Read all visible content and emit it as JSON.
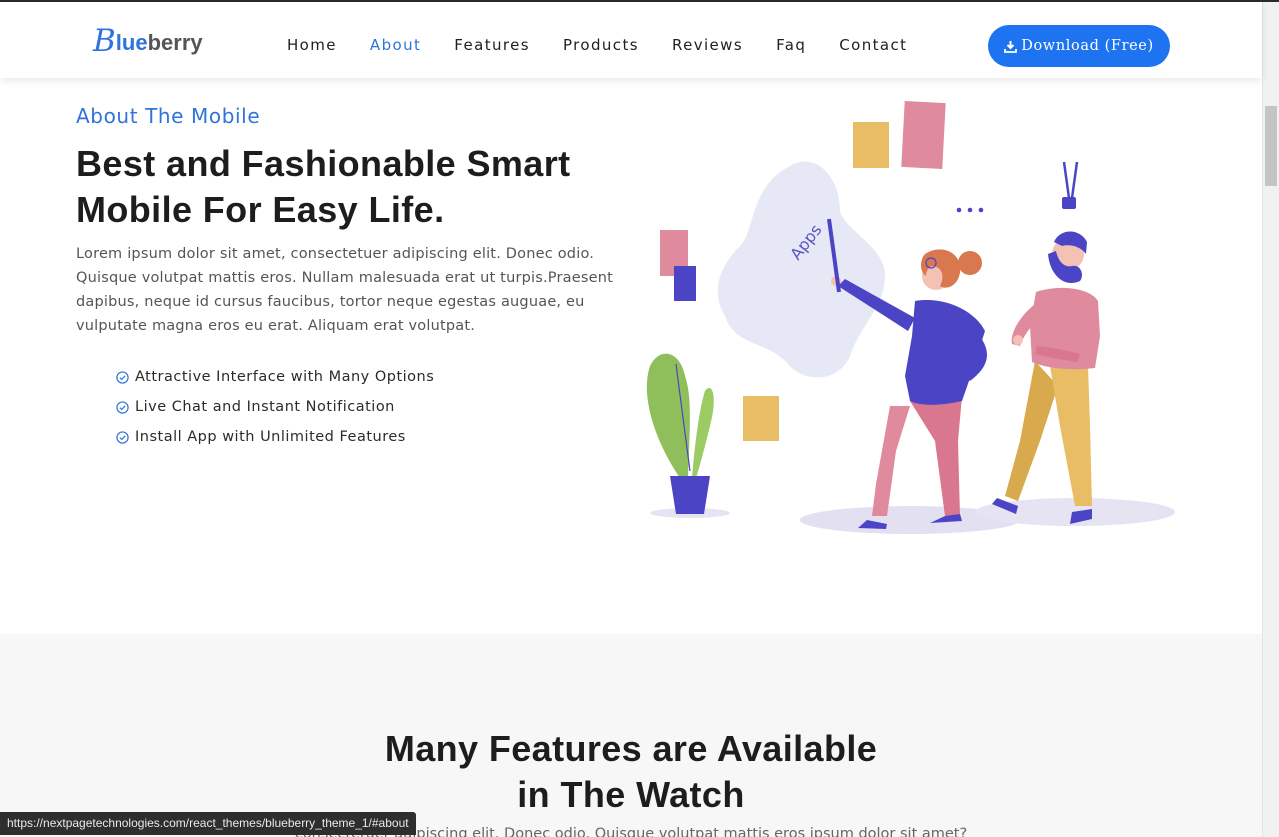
{
  "brand": {
    "letter": "B",
    "part_blue": "lue",
    "part_gray": "berry"
  },
  "nav": {
    "items": [
      {
        "label": "Home"
      },
      {
        "label": "About",
        "active": true
      },
      {
        "label": "Features"
      },
      {
        "label": "Products"
      },
      {
        "label": "Reviews"
      },
      {
        "label": "Faq"
      },
      {
        "label": "Contact"
      }
    ],
    "download_label": "Download (Free)"
  },
  "about": {
    "kicker": "About The Mobile",
    "title": "Best and Fashionable Smart Mobile For Easy Life.",
    "body": "Lorem ipsum dolor sit amet, consectetuer adipiscing elit. Donec odio. Quisque volutpat mattis eros. Nullam malesuada erat ut turpis.Praesent dapibus, neque id cursus faucibus, tortor neque egestas auguae, eu vulputate magna eros eu erat. Aliquam erat volutpat.",
    "features": [
      "Attractive Interface with Many Options",
      "Live Chat and Instant Notification",
      "Install App with Unlimited Features"
    ],
    "illustration_text": "Apps"
  },
  "features_section": {
    "title_line1": "Many Features are Available",
    "title_line2": "in The Watch",
    "subtitle": "consectetuer adipiscing elit. Donec odio. Quisque volutpat mattis eros ipsum dolor sit amet?"
  },
  "status_bar": {
    "url": "https://nextpagetechnologies.com/react_themes/blueberry_theme_1/#about"
  },
  "colors": {
    "accent": "#2f74d8",
    "button": "#1e73f0",
    "heading": "#1d1d1d",
    "illustration_purple": "#4b44c4",
    "illustration_pink": "#e08a9e",
    "illustration_yellow": "#e8bd66",
    "illustration_green": "#8fbf5a"
  },
  "icons": {
    "download": "download-icon",
    "check": "check-circle-icon"
  }
}
